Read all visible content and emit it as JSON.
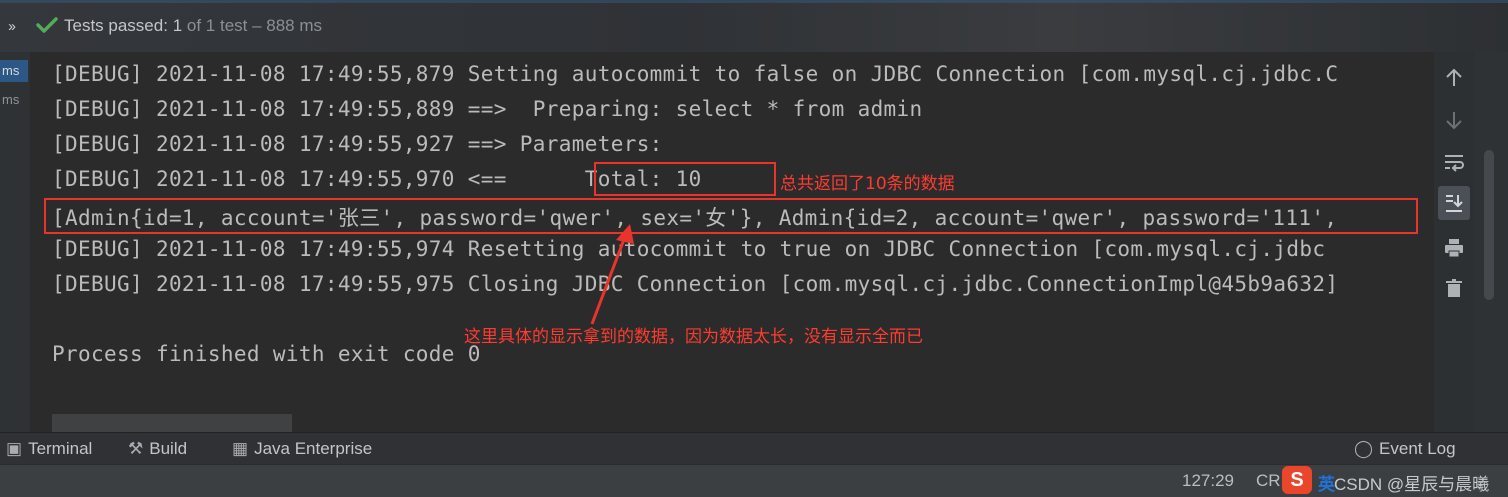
{
  "test_status": {
    "chevrons": "››",
    "label": "Tests passed:",
    "count": "1",
    "detail": "of 1 test – 888 ms"
  },
  "gutter": {
    "time1": "ms",
    "time2": "ms"
  },
  "console": {
    "lines": [
      "[DEBUG] 2021-11-08 17:49:55,879 Setting autocommit to false on JDBC Connection [com.mysql.cj.jdbc.C",
      "[DEBUG] 2021-11-08 17:49:55,889 ==>  Preparing: select * from admin",
      "[DEBUG] 2021-11-08 17:49:55,927 ==> Parameters: ",
      "[DEBUG] 2021-11-08 17:49:55,970 <==      Total: 10",
      "[Admin{id=1, account='张三', password='qwer', sex='女'}, Admin{id=2, account='qwer', password='111',",
      "[DEBUG] 2021-11-08 17:49:55,974 Resetting autocommit to true on JDBC Connection [com.mysql.cj.jdbc",
      "[DEBUG] 2021-11-08 17:49:55,975 Closing JDBC Connection [com.mysql.cj.jdbc.ConnectionImpl@45b9a632]",
      "",
      "Process finished with exit code 0"
    ]
  },
  "annotations": {
    "total_note": "总共返回了10条的数据",
    "data_note": "这里具体的显示拿到的数据，因为数据太长，没有显示全而已",
    "highlight_color": "#e8342c"
  },
  "right_toolbar": {
    "icons": [
      "arrow-up-icon",
      "arrow-down-icon",
      "soft-wrap-icon",
      "scroll-to-end-icon",
      "print-icon",
      "trash-icon"
    ]
  },
  "tool_windows": {
    "terminal": "Terminal",
    "build": "Build",
    "java_enterprise": "Java Enterprise",
    "event_log": "Event Log"
  },
  "status_bar": {
    "position": "127:29",
    "line_sep": "CR",
    "ime_label": "英",
    "watermark": "CSDN @星辰与晨曦"
  },
  "colors": {
    "accent_green": "#4fad5b",
    "console_bg": "#2b2b2b",
    "console_text": "#bbbbbb"
  }
}
